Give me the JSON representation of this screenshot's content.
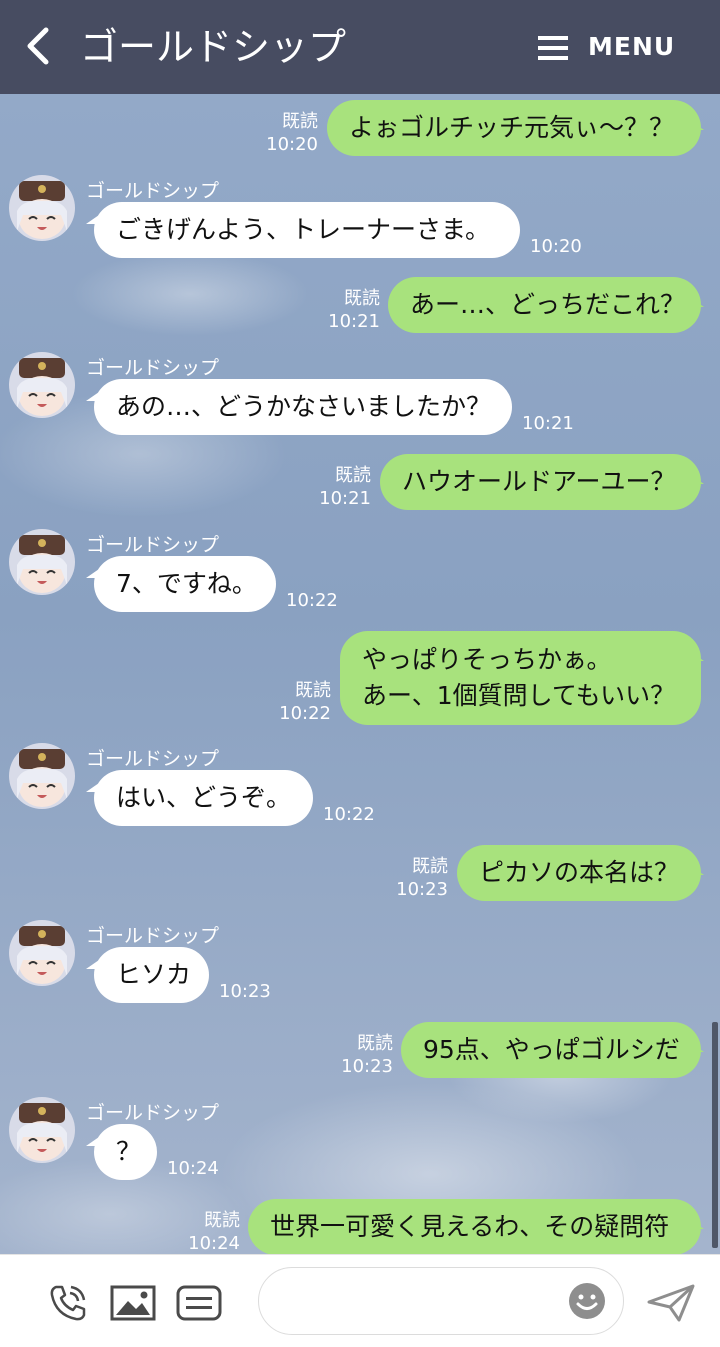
{
  "header": {
    "title": "ゴールドシップ",
    "menu_label": "MENU"
  },
  "chat": {
    "messages": [
      {
        "from": "me",
        "text": "よぉゴルチッチ元気ぃ〜？？",
        "read": "既読",
        "time": "10:20"
      },
      {
        "from": "ゴールドシップ",
        "text": "ごきげんよう、トレーナーさま。",
        "time": "10:20"
      },
      {
        "from": "me",
        "text": "あー…、どっちだこれ？",
        "read": "既読",
        "time": "10:21"
      },
      {
        "from": "ゴールドシップ",
        "text": "あの…、どうかなさいましたか？",
        "time": "10:21"
      },
      {
        "from": "me",
        "text": "ハウオールドアーユー？",
        "read": "既読",
        "time": "10:21"
      },
      {
        "from": "ゴールドシップ",
        "text": "7、ですね。",
        "time": "10:22"
      },
      {
        "from": "me",
        "line1": "やっぱりそっちかぁ。",
        "line2": "あー、1個質問してもいい？",
        "read": "既読",
        "time": "10:22"
      },
      {
        "from": "ゴールドシップ",
        "text": "はい、どうぞ。",
        "time": "10:22"
      },
      {
        "from": "me",
        "text": "ピカソの本名は？",
        "read": "既読",
        "time": "10:23"
      },
      {
        "from": "ゴールドシップ",
        "text": "ヒソカ",
        "time": "10:23"
      },
      {
        "from": "me",
        "text": "95点、やっぱゴルシだ",
        "read": "既読",
        "time": "10:23"
      },
      {
        "from": "ゴールドシップ",
        "text": "？",
        "time": "10:24"
      },
      {
        "from": "me",
        "text": "世界一可愛く見えるわ、その疑問符",
        "read": "既読",
        "time": "10:24"
      }
    ]
  },
  "footer": {
    "input_placeholder": ""
  },
  "icons": [
    "back-icon",
    "menu-icon",
    "phone-icon",
    "image-icon",
    "template-icon",
    "emoji-icon",
    "send-icon"
  ],
  "colors": {
    "header": "#474c61",
    "sent_bubble": "#a8e27d",
    "received_bubble": "#ffffff",
    "chat_background": "#8ea4c3"
  }
}
